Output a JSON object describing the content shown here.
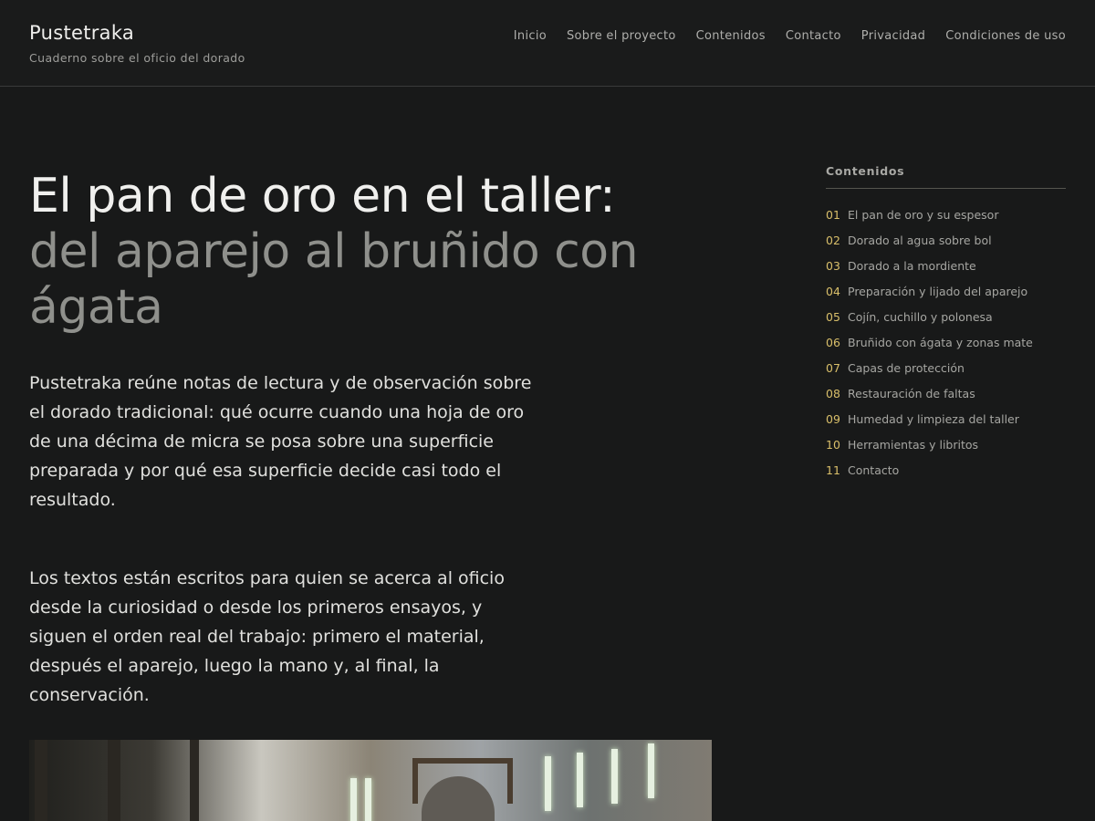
{
  "site": {
    "title": "Pustetraka",
    "tagline": "Cuaderno sobre el oficio del dorado"
  },
  "nav": [
    {
      "label": "Inicio"
    },
    {
      "label": "Sobre el proyecto"
    },
    {
      "label": "Contenidos"
    },
    {
      "label": "Contacto"
    },
    {
      "label": "Privacidad"
    },
    {
      "label": "Condiciones de uso"
    }
  ],
  "article": {
    "title_primary": "El pan de oro en el taller:",
    "title_secondary": "del aparejo al bruñido con ágata",
    "intro": [
      "Pustetraka reúne notas de lectura y de observación sobre el dorado tradicional: qué ocurre cuando una hoja de oro de una décima de micra se posa sobre una superficie preparada y por qué esa superficie decide casi todo el resultado.",
      "Los textos están escritos para quien se acerca al oficio desde la curiosidad o desde los primeros ensayos, y siguen el orden real del trabajo: primero el material, después el aparejo, luego la mano y, al final, la conservación."
    ]
  },
  "toc": {
    "title": "Contenidos",
    "items": [
      {
        "num": "01",
        "label": "El pan de oro y su espesor"
      },
      {
        "num": "02",
        "label": "Dorado al agua sobre bol"
      },
      {
        "num": "03",
        "label": "Dorado a la mordiente"
      },
      {
        "num": "04",
        "label": "Preparación y lijado del aparejo"
      },
      {
        "num": "05",
        "label": "Cojín, cuchillo y polonesa"
      },
      {
        "num": "06",
        "label": "Bruñido con ágata y zonas mate"
      },
      {
        "num": "07",
        "label": "Capas de protección"
      },
      {
        "num": "08",
        "label": "Restauración de faltas"
      },
      {
        "num": "09",
        "label": "Humedad y limpieza del taller"
      },
      {
        "num": "10",
        "label": "Herramientas y libritos"
      },
      {
        "num": "11",
        "label": "Contacto"
      }
    ]
  },
  "colors": {
    "background": "#181919",
    "accent_number": "#d9bf6a",
    "title_muted": "#8f908c"
  }
}
